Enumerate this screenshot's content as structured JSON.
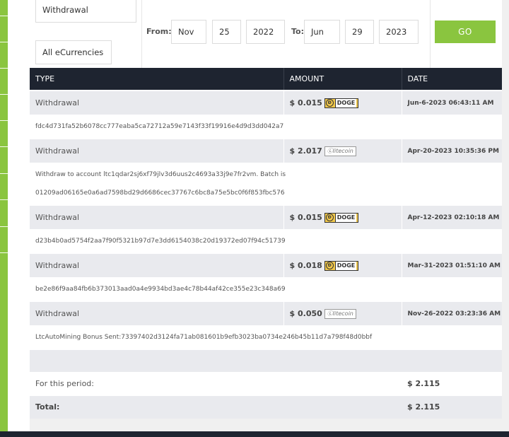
{
  "filter": {
    "type_select": "Withdrawal",
    "currency_select": "All eCurrencies",
    "from_label": "From:",
    "from_month": "Nov",
    "from_day": "25",
    "from_year": "2022",
    "to_label": "To:",
    "to_month": "Jun",
    "to_day": "29",
    "to_year": "2023",
    "go_label": "GO"
  },
  "table": {
    "headers": {
      "type": "TYPE",
      "amount": "AMOUNT",
      "date": "DATE"
    },
    "rows": [
      {
        "type": "Withdrawal",
        "amount": "$ 0.015",
        "currency": "DOGE",
        "date": "Jun-6-2023 06:43:11 AM",
        "detail": "fdc4d731fa52b6078cc777eaba5ca72712a59e7143f33f19916e4d9d3dd042a7"
      },
      {
        "type": "Withdrawal",
        "amount": "$ 2.017",
        "currency": "litecoin",
        "date": "Apr-20-2023 10:35:36 PM",
        "detail_line1": "Withdraw to account ltc1qdar2sj6xf79jlv3d6uus2c4693a33j9e7fr2vm. Batch is",
        "detail_line2": "01209ad06165e0a6ad7598bd29d6686cec37767c6bc8a75e5bc0f6f853fbc576"
      },
      {
        "type": "Withdrawal",
        "amount": "$ 0.015",
        "currency": "DOGE",
        "date": "Apr-12-2023 02:10:18 AM",
        "detail": "d23b4b0ad5754f2aa7f90f5321b97d7e3dd6154038c20d19372ed07f94c51739"
      },
      {
        "type": "Withdrawal",
        "amount": "$ 0.018",
        "currency": "DOGE",
        "date": "Mar-31-2023 01:51:10 AM",
        "detail": "be2e86f9aa84fb6b373013aad0a4e9934bd3ae4c78b44af42ce355e23c348a69"
      },
      {
        "type": "Withdrawal",
        "amount": "$ 0.050",
        "currency": "litecoin",
        "date": "Nov-26-2022 03:23:36 AM",
        "detail": "LtcAutoMining Bonus Sent:73397402d3124fa71ab081601b9efb3023ba0734e246b45b11d7a798f48d0bbf"
      }
    ],
    "period_label": "For this period:",
    "period_value": "$ 2.115",
    "total_label": "Total:",
    "total_value": "$ 2.115"
  },
  "colors": {
    "accent": "#8ac53f",
    "header_bg": "#1e2430",
    "row_bg": "#e9eaee"
  },
  "icons": {
    "doge_badge": "doge-badge-icon",
    "ltc_badge": "litecoin-badge-icon"
  }
}
